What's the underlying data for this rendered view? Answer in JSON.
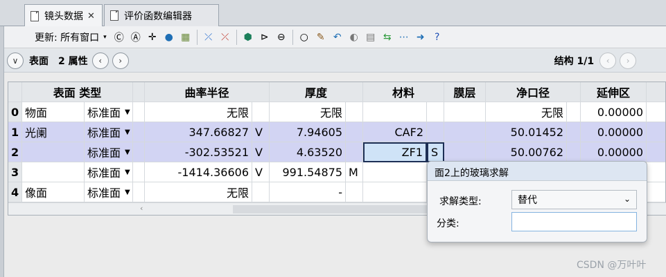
{
  "tabs": [
    {
      "label": "镜头数据",
      "close": "✕"
    },
    {
      "label": "评价函数编辑器"
    }
  ],
  "toolbar": {
    "update_label": "更新: 所有窗口",
    "icons": [
      "refresh-c-icon",
      "refresh-a-icon",
      "crosshair-icon",
      "globe-icon",
      "image-icon",
      "slice-icon",
      "slice-red-icon",
      "lens-icon",
      "mirror-icon",
      "aperture-icon",
      "circle-dropdown-icon",
      "brush-icon",
      "undo-icon",
      "toggle-icon",
      "page-icon",
      "swap-icon",
      "dots-icon",
      "arrow-right-icon",
      "help-icon"
    ]
  },
  "subbar": {
    "surface_label": "表面",
    "props_label": "2 属性",
    "config_label": "结构 1/1"
  },
  "grid": {
    "headers": [
      "表面 类型",
      "曲率半径",
      "厚度",
      "材料",
      "膜层",
      "净口径",
      "延伸区"
    ],
    "rows": [
      {
        "num": "0",
        "name": "物面",
        "type": "标准面",
        "radius": "无限",
        "radius_flag": "",
        "thickness": "无限",
        "thick_flag": "",
        "material": "",
        "mat_flag": "",
        "aperture": "无限",
        "extent": "0.00000"
      },
      {
        "num": "1",
        "name": "光阑",
        "type": "标准面",
        "radius": "347.66827",
        "radius_flag": "V",
        "thickness": "7.94605",
        "thick_flag": "",
        "material": "CAF2",
        "mat_flag": "",
        "aperture": "50.01452",
        "extent": "0.00000"
      },
      {
        "num": "2",
        "name": "",
        "type": "标准面",
        "radius": "-302.53521",
        "radius_flag": "V",
        "thickness": "4.63520",
        "thick_flag": "",
        "material": "ZF1",
        "mat_flag": "S",
        "aperture": "50.00762",
        "extent": "0.00000"
      },
      {
        "num": "3",
        "name": "",
        "type": "标准面",
        "radius": "-1414.36606",
        "radius_flag": "V",
        "thickness": "991.54875",
        "thick_flag": "M",
        "material": "",
        "mat_flag": "",
        "aperture": "",
        "extent": ""
      },
      {
        "num": "4",
        "name": "像面",
        "type": "标准面",
        "radius": "无限",
        "radius_flag": "",
        "thickness": "-",
        "thick_flag": "",
        "material": "",
        "mat_flag": "",
        "aperture": "",
        "extent": ""
      }
    ]
  },
  "popup": {
    "title": "面2上的玻璃求解",
    "solve_type_label": "求解类型:",
    "solve_type_value": "替代",
    "category_label": "分类:",
    "category_value": ""
  },
  "watermark": "CSDN @万叶叶"
}
